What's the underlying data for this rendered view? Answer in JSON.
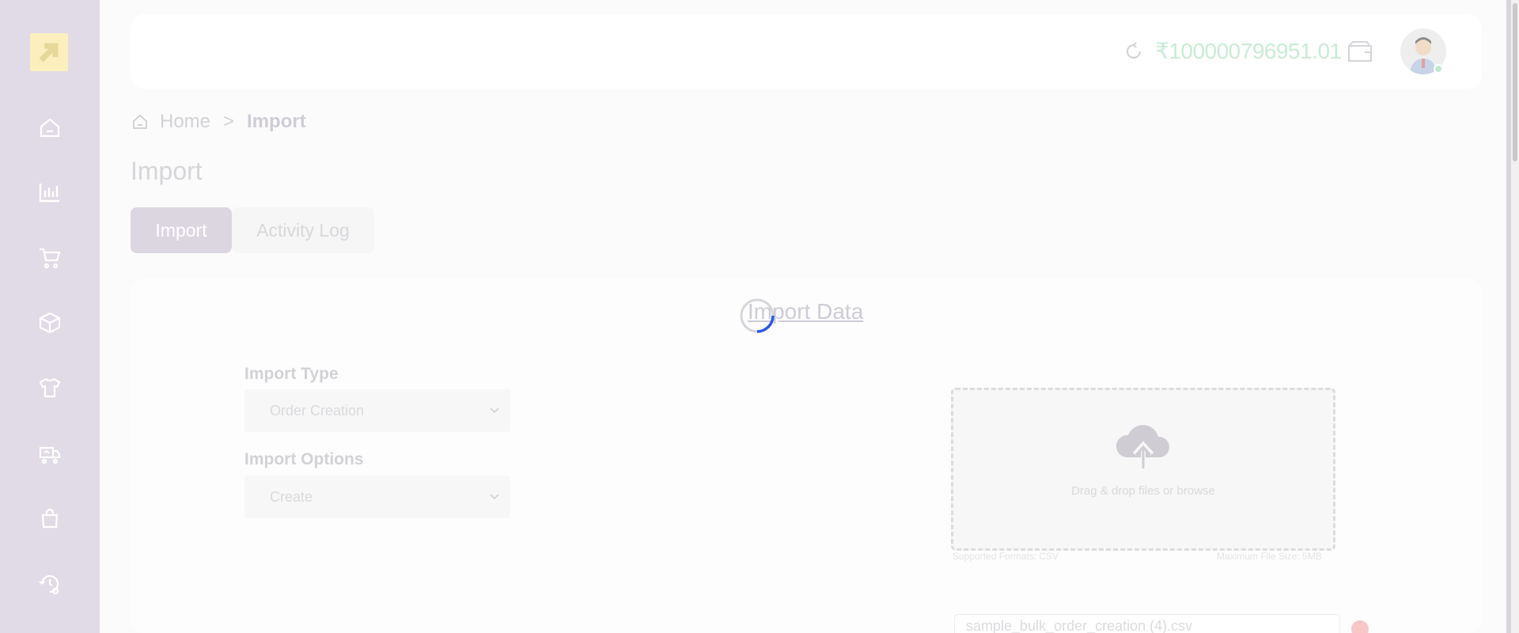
{
  "header": {
    "balance": "₹100000796951.01"
  },
  "breadcrumb": {
    "home": "Home",
    "separator": ">",
    "current": "Import"
  },
  "page": {
    "title": "Import"
  },
  "tabs": [
    {
      "label": "Import",
      "active": true
    },
    {
      "label": "Activity Log",
      "active": false
    }
  ],
  "card": {
    "title": "Import Data"
  },
  "form": {
    "import_type_label": "Import Type",
    "import_type_value": "Order Creation",
    "import_options_label": "Import Options",
    "import_options_value": "Create"
  },
  "upload": {
    "prompt": "Drag & drop files or browse",
    "formats": "Supported Formats: CSV",
    "max_size": "Maximum File Size: 5MB",
    "file_name": "sample_bulk_order_creation (4).csv"
  },
  "sidebar": {
    "items": [
      {
        "icon": "home-icon"
      },
      {
        "icon": "bar-chart-icon"
      },
      {
        "icon": "cart-icon"
      },
      {
        "icon": "box-icon"
      },
      {
        "icon": "tshirt-icon"
      },
      {
        "icon": "truck-icon"
      },
      {
        "icon": "bag-icon"
      },
      {
        "icon": "history-settings-icon"
      }
    ]
  },
  "colors": {
    "sidebar_bg": "#e0dbe6",
    "accent": "#dcd6e1",
    "balance": "#c8ecd5",
    "spinner": "#2b59e8"
  }
}
